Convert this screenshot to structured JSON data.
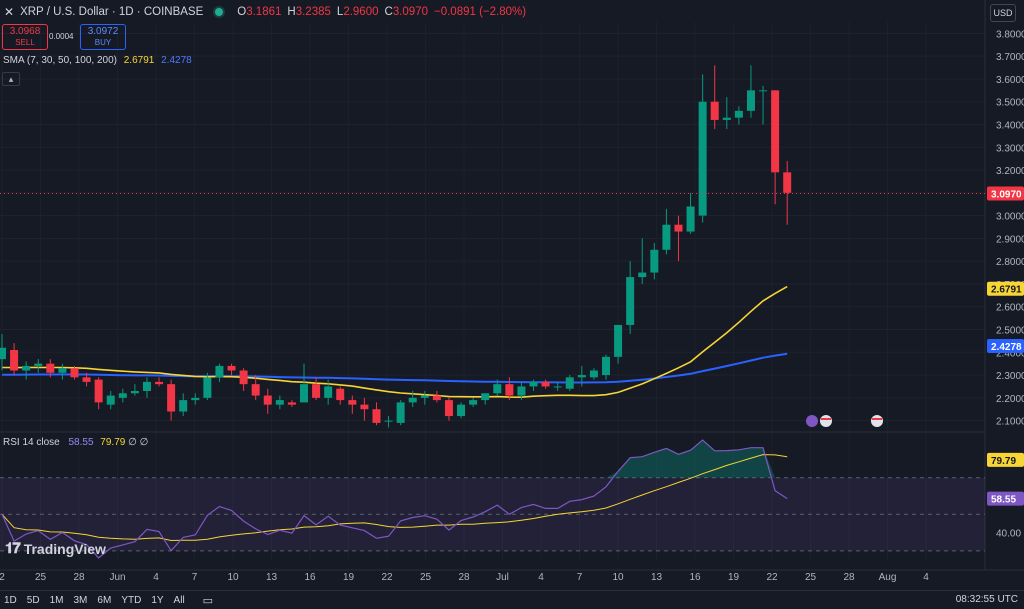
{
  "header": {
    "close_glyph": "✕",
    "symbol": "XRP / U.S. Dollar · 1D · COINBASE",
    "open_label": "O",
    "open_value": "3.1861",
    "high_label": "H",
    "high_value": "3.2385",
    "low_label": "L",
    "low_value": "2.9600",
    "close_label": "C",
    "close_value": "3.0970",
    "change": "−0.0891 (−2.80%)"
  },
  "trade": {
    "sell_price": "3.0968",
    "sell_label": "SELL",
    "spread": "0.0004",
    "buy_price": "3.0972",
    "buy_label": "BUY"
  },
  "indicators": {
    "sma_label": "SMA (7, 30, 50, 100, 200)",
    "sma_val1": "2.6791",
    "sma_val2": "2.4278",
    "rsi_label": "RSI 14 close",
    "rsi_val": "58.55",
    "rsi_ma": "79.79",
    "rsi_extra": "∅ ∅"
  },
  "currency": "USD",
  "colors": {
    "up": "#089981",
    "down": "#f23645",
    "sma_yellow": "#f7d535",
    "sma_blue": "#2962ff",
    "rsi": "#7e57c2"
  },
  "chart_data": {
    "type": "candlestick",
    "price_axis": [
      "3.8000",
      "3.7000",
      "3.6000",
      "3.5000",
      "3.4000",
      "3.3000",
      "3.2000",
      "3.1000",
      "3.0000",
      "2.9000",
      "2.8000",
      "2.7000",
      "2.6000",
      "2.5000",
      "2.4000",
      "2.3000",
      "2.2000",
      "2.1000"
    ],
    "price_range": [
      2.05,
      3.85
    ],
    "last_price": "3.0970",
    "sma_yellow_label": "2.6791",
    "sma_blue_label": "2.4278",
    "rsi_axis": [
      "79.79",
      "58.55",
      "40.00"
    ],
    "rsi_range": [
      25,
      95
    ],
    "x_labels": [
      "2",
      "25",
      "28",
      "Jun",
      "4",
      "7",
      "10",
      "13",
      "16",
      "19",
      "22",
      "25",
      "28",
      "Jul",
      "4",
      "7",
      "10",
      "13",
      "16",
      "19",
      "22",
      "25",
      "28",
      "Aug",
      "4"
    ],
    "candles": [
      {
        "o": 2.37,
        "h": 2.48,
        "l": 2.32,
        "c": 2.42
      },
      {
        "o": 2.41,
        "h": 2.44,
        "l": 2.3,
        "c": 2.32
      },
      {
        "o": 2.32,
        "h": 2.36,
        "l": 2.28,
        "c": 2.34
      },
      {
        "o": 2.34,
        "h": 2.37,
        "l": 2.31,
        "c": 2.35
      },
      {
        "o": 2.35,
        "h": 2.37,
        "l": 2.29,
        "c": 2.31
      },
      {
        "o": 2.31,
        "h": 2.35,
        "l": 2.28,
        "c": 2.33
      },
      {
        "o": 2.33,
        "h": 2.34,
        "l": 2.28,
        "c": 2.29
      },
      {
        "o": 2.29,
        "h": 2.31,
        "l": 2.25,
        "c": 2.27
      },
      {
        "o": 2.28,
        "h": 2.29,
        "l": 2.15,
        "c": 2.18
      },
      {
        "o": 2.17,
        "h": 2.23,
        "l": 2.15,
        "c": 2.21
      },
      {
        "o": 2.2,
        "h": 2.24,
        "l": 2.18,
        "c": 2.22
      },
      {
        "o": 2.22,
        "h": 2.26,
        "l": 2.21,
        "c": 2.23
      },
      {
        "o": 2.23,
        "h": 2.29,
        "l": 2.2,
        "c": 2.27
      },
      {
        "o": 2.27,
        "h": 2.29,
        "l": 2.25,
        "c": 2.26
      },
      {
        "o": 2.26,
        "h": 2.28,
        "l": 2.1,
        "c": 2.14
      },
      {
        "o": 2.14,
        "h": 2.22,
        "l": 2.12,
        "c": 2.19
      },
      {
        "o": 2.19,
        "h": 2.22,
        "l": 2.17,
        "c": 2.2
      },
      {
        "o": 2.2,
        "h": 2.31,
        "l": 2.19,
        "c": 2.29
      },
      {
        "o": 2.29,
        "h": 2.35,
        "l": 2.27,
        "c": 2.34
      },
      {
        "o": 2.34,
        "h": 2.35,
        "l": 2.3,
        "c": 2.32
      },
      {
        "o": 2.32,
        "h": 2.33,
        "l": 2.23,
        "c": 2.26
      },
      {
        "o": 2.26,
        "h": 2.3,
        "l": 2.19,
        "c": 2.21
      },
      {
        "o": 2.21,
        "h": 2.24,
        "l": 2.13,
        "c": 2.17
      },
      {
        "o": 2.17,
        "h": 2.21,
        "l": 2.15,
        "c": 2.19
      },
      {
        "o": 2.18,
        "h": 2.19,
        "l": 2.16,
        "c": 2.17
      },
      {
        "o": 2.18,
        "h": 2.35,
        "l": 2.18,
        "c": 2.26
      },
      {
        "o": 2.26,
        "h": 2.29,
        "l": 2.19,
        "c": 2.2
      },
      {
        "o": 2.2,
        "h": 2.28,
        "l": 2.17,
        "c": 2.25
      },
      {
        "o": 2.24,
        "h": 2.25,
        "l": 2.17,
        "c": 2.19
      },
      {
        "o": 2.19,
        "h": 2.21,
        "l": 2.13,
        "c": 2.17
      },
      {
        "o": 2.17,
        "h": 2.2,
        "l": 2.1,
        "c": 2.15
      },
      {
        "o": 2.15,
        "h": 2.18,
        "l": 2.08,
        "c": 2.09
      },
      {
        "o": 2.1,
        "h": 2.12,
        "l": 2.07,
        "c": 2.1
      },
      {
        "o": 2.09,
        "h": 2.19,
        "l": 2.08,
        "c": 2.18
      },
      {
        "o": 2.18,
        "h": 2.23,
        "l": 2.16,
        "c": 2.2
      },
      {
        "o": 2.2,
        "h": 2.23,
        "l": 2.17,
        "c": 2.21
      },
      {
        "o": 2.21,
        "h": 2.23,
        "l": 2.18,
        "c": 2.19
      },
      {
        "o": 2.19,
        "h": 2.2,
        "l": 2.1,
        "c": 2.12
      },
      {
        "o": 2.12,
        "h": 2.18,
        "l": 2.11,
        "c": 2.17
      },
      {
        "o": 2.17,
        "h": 2.2,
        "l": 2.16,
        "c": 2.19
      },
      {
        "o": 2.19,
        "h": 2.22,
        "l": 2.17,
        "c": 2.22
      },
      {
        "o": 2.22,
        "h": 2.28,
        "l": 2.21,
        "c": 2.26
      },
      {
        "o": 2.26,
        "h": 2.29,
        "l": 2.19,
        "c": 2.21
      },
      {
        "o": 2.21,
        "h": 2.27,
        "l": 2.19,
        "c": 2.25
      },
      {
        "o": 2.25,
        "h": 2.28,
        "l": 2.23,
        "c": 2.27
      },
      {
        "o": 2.27,
        "h": 2.28,
        "l": 2.24,
        "c": 2.25
      },
      {
        "o": 2.25,
        "h": 2.27,
        "l": 2.23,
        "c": 2.25
      },
      {
        "o": 2.24,
        "h": 2.3,
        "l": 2.23,
        "c": 2.29
      },
      {
        "o": 2.29,
        "h": 2.34,
        "l": 2.25,
        "c": 2.3
      },
      {
        "o": 2.29,
        "h": 2.33,
        "l": 2.28,
        "c": 2.32
      },
      {
        "o": 2.3,
        "h": 2.39,
        "l": 2.28,
        "c": 2.38
      },
      {
        "o": 2.38,
        "h": 2.52,
        "l": 2.35,
        "c": 2.52
      },
      {
        "o": 2.52,
        "h": 2.8,
        "l": 2.48,
        "c": 2.73
      },
      {
        "o": 2.73,
        "h": 2.9,
        "l": 2.7,
        "c": 2.75
      },
      {
        "o": 2.75,
        "h": 2.88,
        "l": 2.72,
        "c": 2.85
      },
      {
        "o": 2.85,
        "h": 3.03,
        "l": 2.83,
        "c": 2.96
      },
      {
        "o": 2.96,
        "h": 3.0,
        "l": 2.8,
        "c": 2.93
      },
      {
        "o": 2.93,
        "h": 3.1,
        "l": 2.92,
        "c": 3.04
      },
      {
        "o": 3.0,
        "h": 3.62,
        "l": 2.97,
        "c": 3.5
      },
      {
        "o": 3.5,
        "h": 3.66,
        "l": 3.38,
        "c": 3.42
      },
      {
        "o": 3.42,
        "h": 3.52,
        "l": 3.38,
        "c": 3.43
      },
      {
        "o": 3.43,
        "h": 3.48,
        "l": 3.4,
        "c": 3.46
      },
      {
        "o": 3.46,
        "h": 3.66,
        "l": 3.43,
        "c": 3.55
      },
      {
        "o": 3.55,
        "h": 3.57,
        "l": 3.4,
        "c": 3.55
      },
      {
        "o": 3.55,
        "h": 3.55,
        "l": 3.05,
        "c": 3.19
      },
      {
        "o": 3.19,
        "h": 3.24,
        "l": 2.96,
        "c": 3.1
      }
    ]
  },
  "time_ranges": [
    "1D",
    "5D",
    "1M",
    "3M",
    "6M",
    "YTD",
    "1Y",
    "All"
  ],
  "clock": "08:32:55 UTC",
  "brand": "TradingView"
}
